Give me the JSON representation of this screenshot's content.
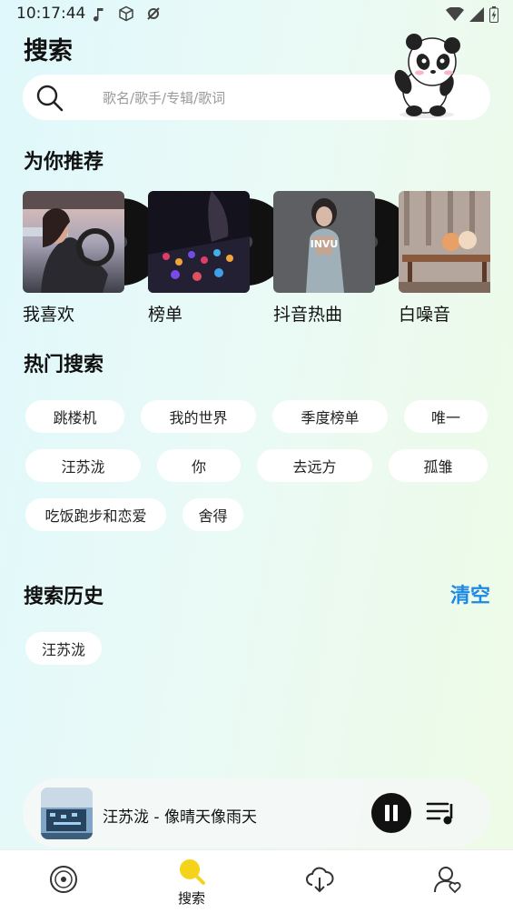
{
  "status_bar": {
    "time": "10:17:44"
  },
  "page": {
    "title": "搜索"
  },
  "search": {
    "placeholder": "歌名/歌手/专辑/歌词"
  },
  "recommend": {
    "title": "为你推荐",
    "items": [
      {
        "label": "我喜欢",
        "cover_icon": "girl-in-car-photo"
      },
      {
        "label": "榜单",
        "cover_icon": "dj-mixer-photo"
      },
      {
        "label": "抖音热曲",
        "cover_icon": "woman-album-photo",
        "cover_text": "INVU"
      },
      {
        "label": "白噪音",
        "cover_icon": "bench-bears-photo"
      }
    ]
  },
  "hot_search": {
    "title": "热门搜索",
    "chips": [
      "跳楼机",
      "我的世界",
      "季度榜单",
      "唯一",
      "汪苏泷",
      "你",
      "去远方",
      "孤雏",
      "吃饭跑步和恋爱",
      "舍得"
    ]
  },
  "history": {
    "title": "搜索历史",
    "clear_label": "清空",
    "chips": [
      "汪苏泷"
    ]
  },
  "player": {
    "title": "汪苏泷 - 像晴天像雨天",
    "state": "playing"
  },
  "tabs": [
    {
      "icon": "vinyl-disc-icon",
      "label": ""
    },
    {
      "icon": "search-icon",
      "label": "搜索",
      "active": true
    },
    {
      "icon": "cloud-download-icon",
      "label": ""
    },
    {
      "icon": "user-heart-icon",
      "label": ""
    }
  ],
  "colors": {
    "accent": "#1e88e5",
    "active_tab": "#f5d31b"
  }
}
